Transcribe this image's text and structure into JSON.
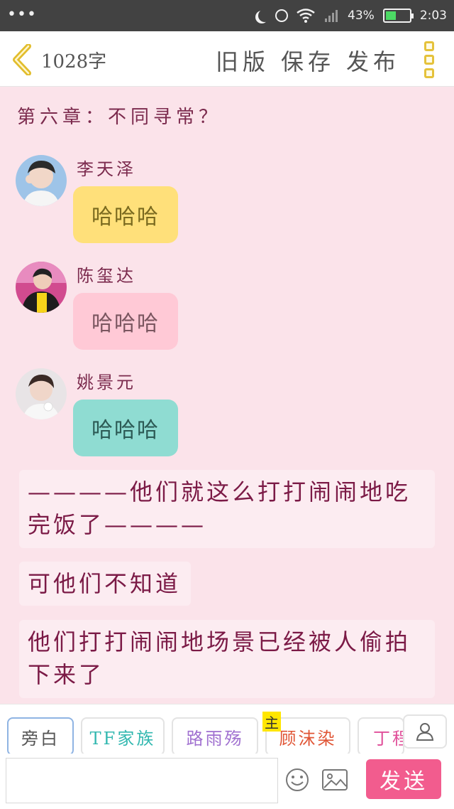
{
  "status_bar": {
    "dots": "•••",
    "battery_percent": "43%",
    "battery_level": 0.43,
    "time": "2:03"
  },
  "header": {
    "word_count": "1028字",
    "old_version": "旧版",
    "save": "保存",
    "publish": "发布"
  },
  "chapter_title": "第六章：不同寻常？",
  "messages": [
    {
      "name": "李天泽",
      "text": "哈哈哈",
      "bubble_color": "#ffe07a",
      "text_color": "#7a6a1f"
    },
    {
      "name": "陈玺达",
      "text": "哈哈哈",
      "bubble_color": "#ffc9d6",
      "text_color": "#7a5660"
    },
    {
      "name": "姚景元",
      "text": "哈哈哈",
      "bubble_color": "#8fdcd2",
      "text_color": "#2c5a55"
    }
  ],
  "narrations": [
    {
      "line1": "————他们就这么打打闹闹地吃",
      "line2": "完饭了————"
    },
    {
      "line1": "可他们不知道"
    },
    {
      "line1": "他们打打闹闹地场景已经被人偷拍",
      "line2": "下来了"
    }
  ],
  "roles": [
    {
      "label": "旁白",
      "color": "#555555"
    },
    {
      "label": "TF家族",
      "color": "#33b8b0"
    },
    {
      "label": "路雨殇",
      "color": "#a070d0"
    },
    {
      "label": "顾沫染",
      "color": "#e05535"
    },
    {
      "label": "丁程",
      "color": "#e0509a"
    }
  ],
  "main_tag": "主",
  "input": {
    "value": ""
  },
  "send_label": "发送",
  "colors": {
    "accent": "#f25c8e",
    "background": "#fbe3ea",
    "text": "#7b2a4d"
  }
}
